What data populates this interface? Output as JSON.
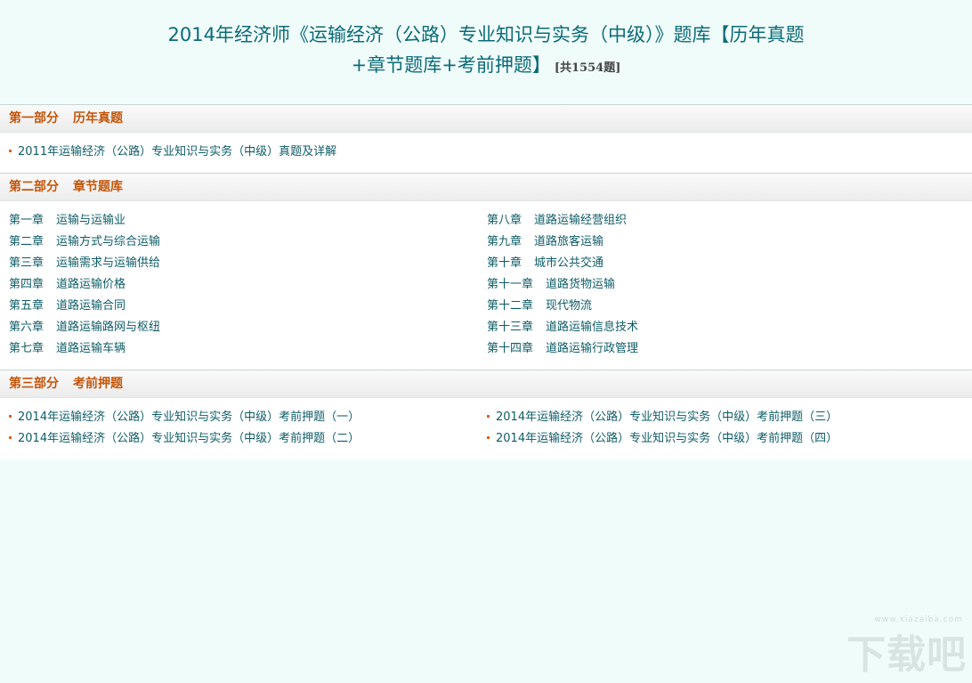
{
  "page": {
    "title_line1": "2014年经济师《运输经济（公路）专业知识与实务（中级）》题库【历年真题",
    "title_line2": "+章节题库+考前押题】",
    "count": "[共1554题]"
  },
  "sections": [
    {
      "part": "第一部分",
      "name": "历年真题",
      "items": [
        "2011年运输经济（公路）专业知识与实务（中级）真题及详解"
      ]
    },
    {
      "part": "第二部分",
      "name": "章节题库",
      "left": [
        {
          "ch": "第一章",
          "name": "运输与运输业"
        },
        {
          "ch": "第二章",
          "name": "运输方式与综合运输"
        },
        {
          "ch": "第三章",
          "name": "运输需求与运输供给"
        },
        {
          "ch": "第四章",
          "name": "道路运输价格"
        },
        {
          "ch": "第五章",
          "name": "道路运输合同"
        },
        {
          "ch": "第六章",
          "name": "道路运输路网与枢纽"
        },
        {
          "ch": "第七章",
          "name": "道路运输车辆"
        }
      ],
      "right": [
        {
          "ch": "第八章",
          "name": "道路运输经营组织"
        },
        {
          "ch": "第九章",
          "name": "道路旅客运输"
        },
        {
          "ch": "第十章",
          "name": "城市公共交通"
        },
        {
          "ch": "第十一章",
          "name": "道路货物运输"
        },
        {
          "ch": "第十二章",
          "name": "现代物流"
        },
        {
          "ch": "第十三章",
          "name": "道路运输信息技术"
        },
        {
          "ch": "第十四章",
          "name": "道路运输行政管理"
        }
      ]
    },
    {
      "part": "第三部分",
      "name": "考前押题",
      "left": [
        "2014年运输经济（公路）专业知识与实务（中级）考前押题（一）",
        "2014年运输经济（公路）专业知识与实务（中级）考前押题（二）"
      ],
      "right": [
        "2014年运输经济（公路）专业知识与实务（中级）考前押题（三）",
        "2014年运输经济（公路）专业知识与实务（中级）考前押题（四）"
      ]
    }
  ],
  "watermark": {
    "text": "下载吧",
    "sub": "www.xiazaiba.com"
  }
}
